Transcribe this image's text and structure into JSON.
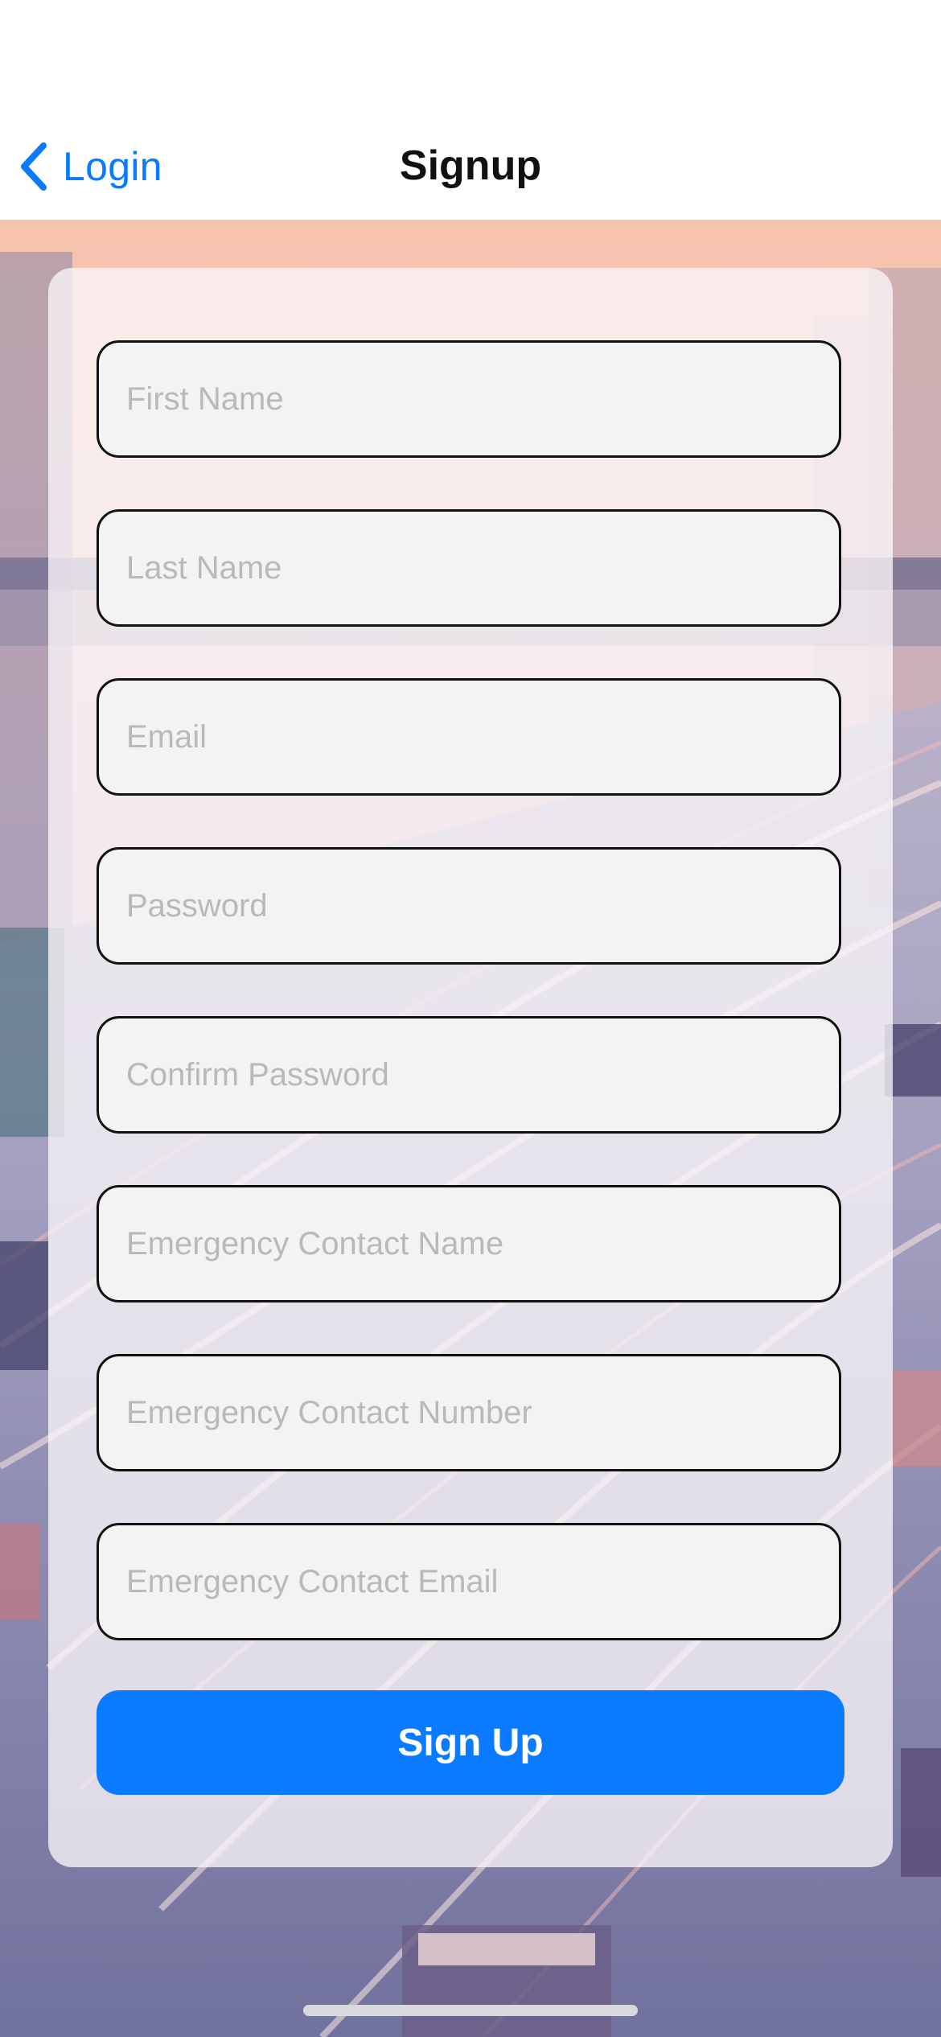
{
  "nav": {
    "back_label": "Login",
    "title": "Signup"
  },
  "form": {
    "fields": [
      {
        "placeholder": "First Name",
        "value": ""
      },
      {
        "placeholder": "Last Name",
        "value": ""
      },
      {
        "placeholder": "Email",
        "value": ""
      },
      {
        "placeholder": "Password",
        "value": ""
      },
      {
        "placeholder": "Confirm Password",
        "value": ""
      },
      {
        "placeholder": "Emergency Contact Name",
        "value": ""
      },
      {
        "placeholder": "Emergency Contact Number",
        "value": ""
      },
      {
        "placeholder": "Emergency Contact Email",
        "value": ""
      }
    ],
    "submit_label": "Sign Up"
  },
  "icons": {
    "back": "chevron-left-icon"
  },
  "colors": {
    "accent": "#0a7aff",
    "field_border": "#111111",
    "field_fill": "#f3f3f3",
    "placeholder": "#b8b8bd"
  }
}
